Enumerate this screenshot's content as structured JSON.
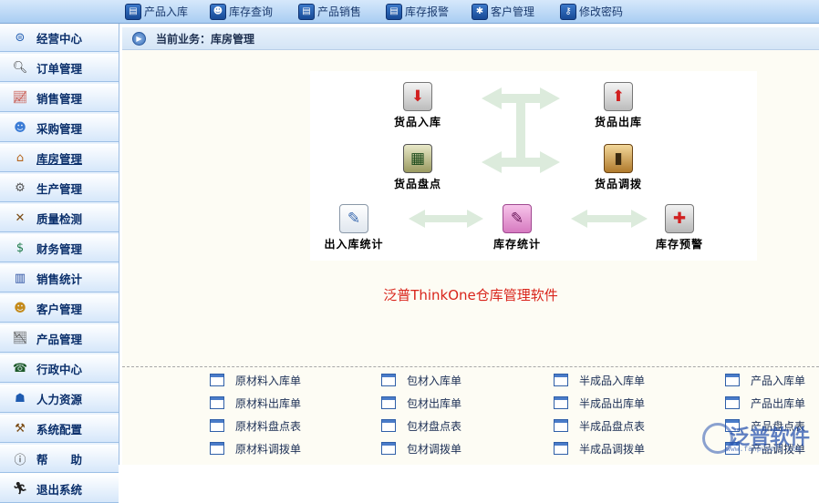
{
  "toolbar": {
    "items": [
      {
        "label": "产品入库",
        "icon": "doc-in-icon"
      },
      {
        "label": "库存查询",
        "icon": "users-icon"
      },
      {
        "label": "产品销售",
        "icon": "doc-sell-icon"
      },
      {
        "label": "库存报警",
        "icon": "doc-alarm-icon"
      },
      {
        "label": "客户管理",
        "icon": "customer-icon"
      },
      {
        "label": "修改密码",
        "icon": "key-icon"
      }
    ]
  },
  "sidebar": {
    "items": [
      {
        "label": "经营中心",
        "icon": "dashboard-icon"
      },
      {
        "label": "订单管理",
        "icon": "magnifier-icon"
      },
      {
        "label": "销售管理",
        "icon": "chart-line-icon"
      },
      {
        "label": "采购管理",
        "icon": "people-icon"
      },
      {
        "label": "库房管理",
        "icon": "house-icon"
      },
      {
        "label": "生产管理",
        "icon": "gears-icon"
      },
      {
        "label": "质量检测",
        "icon": "tools-icon"
      },
      {
        "label": "财务管理",
        "icon": "money-icon"
      },
      {
        "label": "销售统计",
        "icon": "bar-chart-icon"
      },
      {
        "label": "客户管理",
        "icon": "customers-icon"
      },
      {
        "label": "产品管理",
        "icon": "trend-icon"
      },
      {
        "label": "行政中心",
        "icon": "phone-icon"
      },
      {
        "label": "人力资源",
        "icon": "group-icon"
      },
      {
        "label": "系统配置",
        "icon": "hammer-icon"
      },
      {
        "label": "帮　　助",
        "icon": "help-icon"
      },
      {
        "label": "退出系统",
        "icon": "exit-icon"
      }
    ],
    "active": "库房管理"
  },
  "breadcrumb": {
    "text": "当前业务：库房管理"
  },
  "flow": {
    "nodes": {
      "goods_in": "货品入库",
      "goods_out": "货品出库",
      "goods_check": "货品盘点",
      "goods_transfer": "货品调拨",
      "in_out_stats": "出入库统计",
      "stock_stats": "库存统计",
      "stock_alert": "库存预警"
    }
  },
  "app_title": "泛普ThinkOne仓库管理软件",
  "links": {
    "columns": [
      [
        "原材料入库单",
        "原材料出库单",
        "原材料盘点表",
        "原材料调拨单"
      ],
      [
        "包材入库单",
        "包材出库单",
        "包材盘点表",
        "包材调拨单"
      ],
      [
        "半成品入库单",
        "半成品出库单",
        "半成品盘点表",
        "半成品调拨单"
      ],
      [
        "产品入库单",
        "产品出库单",
        "产品盘点表",
        "产品调拨单"
      ]
    ]
  },
  "watermark": {
    "brand": "泛普软件",
    "url": "www.fanpusoft.com"
  },
  "colors": {
    "accent": "#d9251c",
    "nav_text": "#0a2f6b",
    "toolbar_bg": "#a9cdf2"
  }
}
